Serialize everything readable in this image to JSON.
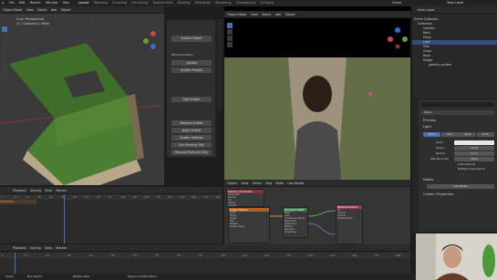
{
  "menubar": {
    "items": [
      "File",
      "Edit",
      "Render",
      "Window",
      "Help"
    ],
    "workspace_tabs": [
      "Layout",
      "Modeling",
      "Sculpting",
      "UV Editing",
      "Texture Paint",
      "Shading",
      "Animation",
      "Rendering",
      "Compositing",
      "Scripting"
    ],
    "active_tab": "Layout",
    "scene": "Scene",
    "view_layer": "View Layer"
  },
  "viewport_left": {
    "header": [
      "Object Mode",
      "View",
      "Select",
      "Add",
      "Object"
    ],
    "info_line1": "User Perspective",
    "info_line2": "(1) Collection | Rock"
  },
  "addon_panel": {
    "buttons": [
      "Scatter Object",
      "Wind Animation",
      "Update",
      "Scatter Presets",
      "Add Scatter",
      "Remove Scatter",
      "Apply Scatter",
      "Scatter Settings",
      "Run Painting Tool",
      "Remove Particles Only"
    ]
  },
  "viewport_right": {
    "header": [
      "Object Mode",
      "View",
      "Select",
      "Add",
      "Object"
    ],
    "gizmo_labels": [
      "X",
      "Y",
      "Z"
    ]
  },
  "node_editor": {
    "header": [
      "Object",
      "View",
      "Select",
      "Add",
      "Node",
      "Use Nodes"
    ],
    "nodes": [
      {
        "title": "Texture Coordinate",
        "rows": [
          "Generated",
          "Normal",
          "UV",
          "Object",
          "Camera"
        ]
      },
      {
        "title": "Image Texture",
        "rows": [
          "Color",
          "Alpha",
          "Linear",
          "Flat",
          "Repeat",
          "Single Image"
        ]
      },
      {
        "title": "Principled BSDF",
        "rows": [
          "BSDF",
          "GGX",
          "Christensen-Burley",
          "Base Color",
          "Subsurface",
          "Metallic",
          "Specular",
          "Roughness"
        ]
      },
      {
        "title": "Material Output",
        "rows": [
          "All",
          "Surface",
          "Volume",
          "Displacement"
        ]
      }
    ]
  },
  "dopesheet": {
    "header": [
      "Playback",
      "Keying",
      "View",
      "Marker"
    ],
    "summary": "Summary",
    "frame_numbers": [
      "0",
      "10",
      "20",
      "30",
      "40",
      "50",
      "60",
      "70",
      "80",
      "90",
      "100",
      "110",
      "120",
      "130",
      "140",
      "150",
      "160",
      "170",
      "180"
    ]
  },
  "timeline": {
    "header": [
      "Playback",
      "Keying",
      "View",
      "Marker"
    ],
    "current_frame": "1",
    "start": "1",
    "end": "250"
  },
  "outliner": {
    "title": "View Layer",
    "rows": [
      {
        "label": "Scene Collection",
        "indent": 0,
        "selected": false
      },
      {
        "label": "Collection",
        "indent": 1,
        "selected": false
      },
      {
        "label": "Camera",
        "indent": 2,
        "selected": false
      },
      {
        "label": "Rock",
        "indent": 2,
        "selected": false
      },
      {
        "label": "Plane",
        "indent": 2,
        "selected": false
      },
      {
        "label": "Light",
        "indent": 2,
        "selected": true
      },
      {
        "label": "Tree",
        "indent": 2,
        "selected": false
      },
      {
        "label": "Grass",
        "indent": 2,
        "selected": false
      },
      {
        "label": "Bush",
        "indent": 2,
        "selected": false
      },
      {
        "label": "Hedge",
        "indent": 2,
        "selected": false
      },
      {
        "label": "particle_system",
        "indent": 3,
        "selected": false
      }
    ]
  },
  "properties": {
    "search_placeholder": "",
    "object_name": "Plane",
    "sections": [
      "Preview",
      "Light",
      "Nodes",
      "Custom Properties"
    ],
    "light_types": [
      "Point",
      "Sun",
      "Spot",
      "Area"
    ],
    "fields": [
      {
        "label": "Color",
        "value": ""
      },
      {
        "label": "Power",
        "value": "10 W"
      },
      {
        "label": "Radius",
        "value": "0.1 m"
      },
      {
        "label": "Max Bounces",
        "value": "1024"
      },
      {
        "label": "",
        "value": "Cast Shadow"
      },
      {
        "label": "",
        "value": "Multiple Importance"
      }
    ],
    "use_nodes_button": "Use Nodes"
  },
  "status_bar": {
    "items": [
      "Select",
      "Box Select",
      "Rotate View",
      "Object Context Menu"
    ]
  },
  "colors": {
    "accent": "#4772b3",
    "header_bg": "#2b2b2b",
    "panel_bg": "#303030",
    "playhead": "#4772b3"
  }
}
